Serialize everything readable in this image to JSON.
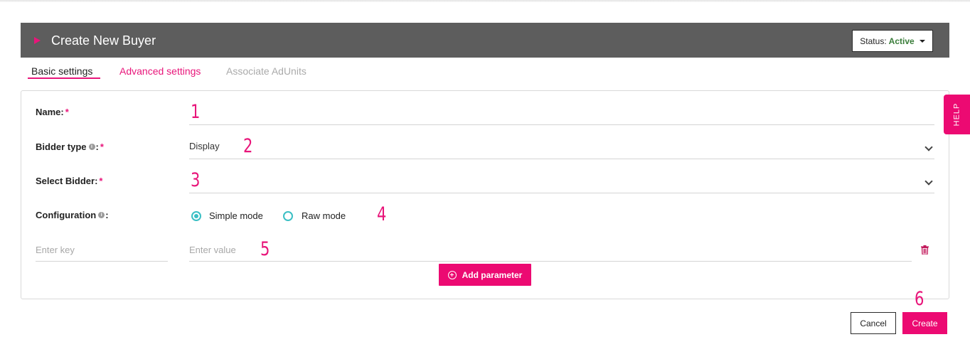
{
  "header": {
    "title": "Create New Buyer",
    "status_prefix": "Status:",
    "status_value": "Active"
  },
  "tabs": [
    {
      "label": "Basic settings",
      "state": "active"
    },
    {
      "label": "Advanced settings",
      "state": "enabled"
    },
    {
      "label": "Associate AdUnits",
      "state": "disabled"
    }
  ],
  "form": {
    "name_label": "Name:",
    "bidder_type_label": "Bidder type",
    "bidder_type_value": "Display",
    "select_bidder_label": "Select Bidder:",
    "configuration_label": "Configuration",
    "required_mark": "*",
    "colon": ":",
    "info_glyph": "i",
    "simple_mode_label": "Simple mode",
    "raw_mode_label": "Raw mode",
    "key_placeholder": "Enter key",
    "value_placeholder": "Enter value",
    "add_parameter_label": "Add parameter"
  },
  "annotations": [
    "1",
    "2",
    "3",
    "4",
    "5",
    "6"
  ],
  "help_label": "HELP",
  "footer": {
    "cancel_label": "Cancel",
    "create_label": "Create"
  },
  "colors": {
    "accent": "#ec0a72",
    "header_bg": "#5d5d5d",
    "radio": "#3bbfc4",
    "status_active": "#3a7d3a"
  }
}
